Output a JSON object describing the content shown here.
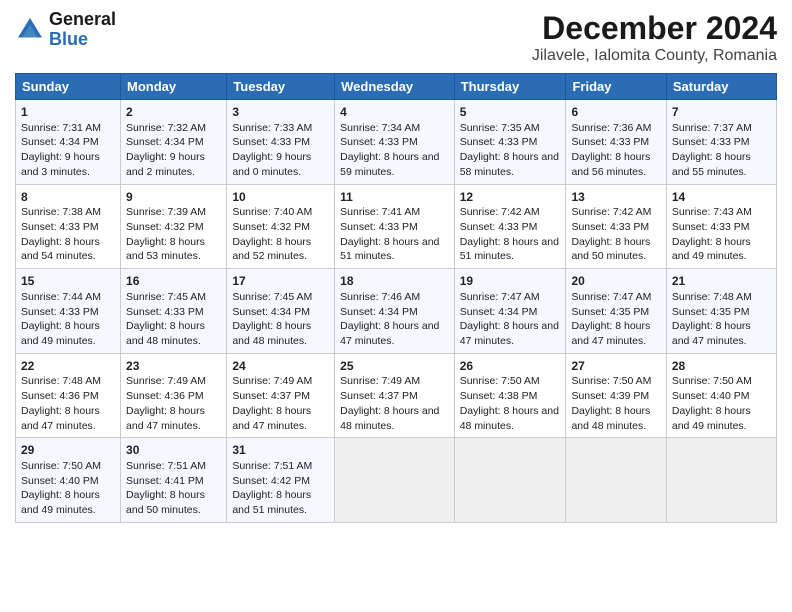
{
  "header": {
    "logo_line1": "General",
    "logo_line2": "Blue",
    "title": "December 2024",
    "subtitle": "Jilavele, Ialomita County, Romania"
  },
  "days_of_week": [
    "Sunday",
    "Monday",
    "Tuesday",
    "Wednesday",
    "Thursday",
    "Friday",
    "Saturday"
  ],
  "weeks": [
    {
      "days": [
        {
          "num": "1",
          "sunrise": "Sunrise: 7:31 AM",
          "sunset": "Sunset: 4:34 PM",
          "daylight": "Daylight: 9 hours and 3 minutes."
        },
        {
          "num": "2",
          "sunrise": "Sunrise: 7:32 AM",
          "sunset": "Sunset: 4:34 PM",
          "daylight": "Daylight: 9 hours and 2 minutes."
        },
        {
          "num": "3",
          "sunrise": "Sunrise: 7:33 AM",
          "sunset": "Sunset: 4:33 PM",
          "daylight": "Daylight: 9 hours and 0 minutes."
        },
        {
          "num": "4",
          "sunrise": "Sunrise: 7:34 AM",
          "sunset": "Sunset: 4:33 PM",
          "daylight": "Daylight: 8 hours and 59 minutes."
        },
        {
          "num": "5",
          "sunrise": "Sunrise: 7:35 AM",
          "sunset": "Sunset: 4:33 PM",
          "daylight": "Daylight: 8 hours and 58 minutes."
        },
        {
          "num": "6",
          "sunrise": "Sunrise: 7:36 AM",
          "sunset": "Sunset: 4:33 PM",
          "daylight": "Daylight: 8 hours and 56 minutes."
        },
        {
          "num": "7",
          "sunrise": "Sunrise: 7:37 AM",
          "sunset": "Sunset: 4:33 PM",
          "daylight": "Daylight: 8 hours and 55 minutes."
        }
      ]
    },
    {
      "days": [
        {
          "num": "8",
          "sunrise": "Sunrise: 7:38 AM",
          "sunset": "Sunset: 4:33 PM",
          "daylight": "Daylight: 8 hours and 54 minutes."
        },
        {
          "num": "9",
          "sunrise": "Sunrise: 7:39 AM",
          "sunset": "Sunset: 4:32 PM",
          "daylight": "Daylight: 8 hours and 53 minutes."
        },
        {
          "num": "10",
          "sunrise": "Sunrise: 7:40 AM",
          "sunset": "Sunset: 4:32 PM",
          "daylight": "Daylight: 8 hours and 52 minutes."
        },
        {
          "num": "11",
          "sunrise": "Sunrise: 7:41 AM",
          "sunset": "Sunset: 4:33 PM",
          "daylight": "Daylight: 8 hours and 51 minutes."
        },
        {
          "num": "12",
          "sunrise": "Sunrise: 7:42 AM",
          "sunset": "Sunset: 4:33 PM",
          "daylight": "Daylight: 8 hours and 51 minutes."
        },
        {
          "num": "13",
          "sunrise": "Sunrise: 7:42 AM",
          "sunset": "Sunset: 4:33 PM",
          "daylight": "Daylight: 8 hours and 50 minutes."
        },
        {
          "num": "14",
          "sunrise": "Sunrise: 7:43 AM",
          "sunset": "Sunset: 4:33 PM",
          "daylight": "Daylight: 8 hours and 49 minutes."
        }
      ]
    },
    {
      "days": [
        {
          "num": "15",
          "sunrise": "Sunrise: 7:44 AM",
          "sunset": "Sunset: 4:33 PM",
          "daylight": "Daylight: 8 hours and 49 minutes."
        },
        {
          "num": "16",
          "sunrise": "Sunrise: 7:45 AM",
          "sunset": "Sunset: 4:33 PM",
          "daylight": "Daylight: 8 hours and 48 minutes."
        },
        {
          "num": "17",
          "sunrise": "Sunrise: 7:45 AM",
          "sunset": "Sunset: 4:34 PM",
          "daylight": "Daylight: 8 hours and 48 minutes."
        },
        {
          "num": "18",
          "sunrise": "Sunrise: 7:46 AM",
          "sunset": "Sunset: 4:34 PM",
          "daylight": "Daylight: 8 hours and 47 minutes."
        },
        {
          "num": "19",
          "sunrise": "Sunrise: 7:47 AM",
          "sunset": "Sunset: 4:34 PM",
          "daylight": "Daylight: 8 hours and 47 minutes."
        },
        {
          "num": "20",
          "sunrise": "Sunrise: 7:47 AM",
          "sunset": "Sunset: 4:35 PM",
          "daylight": "Daylight: 8 hours and 47 minutes."
        },
        {
          "num": "21",
          "sunrise": "Sunrise: 7:48 AM",
          "sunset": "Sunset: 4:35 PM",
          "daylight": "Daylight: 8 hours and 47 minutes."
        }
      ]
    },
    {
      "days": [
        {
          "num": "22",
          "sunrise": "Sunrise: 7:48 AM",
          "sunset": "Sunset: 4:36 PM",
          "daylight": "Daylight: 8 hours and 47 minutes."
        },
        {
          "num": "23",
          "sunrise": "Sunrise: 7:49 AM",
          "sunset": "Sunset: 4:36 PM",
          "daylight": "Daylight: 8 hours and 47 minutes."
        },
        {
          "num": "24",
          "sunrise": "Sunrise: 7:49 AM",
          "sunset": "Sunset: 4:37 PM",
          "daylight": "Daylight: 8 hours and 47 minutes."
        },
        {
          "num": "25",
          "sunrise": "Sunrise: 7:49 AM",
          "sunset": "Sunset: 4:37 PM",
          "daylight": "Daylight: 8 hours and 48 minutes."
        },
        {
          "num": "26",
          "sunrise": "Sunrise: 7:50 AM",
          "sunset": "Sunset: 4:38 PM",
          "daylight": "Daylight: 8 hours and 48 minutes."
        },
        {
          "num": "27",
          "sunrise": "Sunrise: 7:50 AM",
          "sunset": "Sunset: 4:39 PM",
          "daylight": "Daylight: 8 hours and 48 minutes."
        },
        {
          "num": "28",
          "sunrise": "Sunrise: 7:50 AM",
          "sunset": "Sunset: 4:40 PM",
          "daylight": "Daylight: 8 hours and 49 minutes."
        }
      ]
    },
    {
      "days": [
        {
          "num": "29",
          "sunrise": "Sunrise: 7:50 AM",
          "sunset": "Sunset: 4:40 PM",
          "daylight": "Daylight: 8 hours and 49 minutes."
        },
        {
          "num": "30",
          "sunrise": "Sunrise: 7:51 AM",
          "sunset": "Sunset: 4:41 PM",
          "daylight": "Daylight: 8 hours and 50 minutes."
        },
        {
          "num": "31",
          "sunrise": "Sunrise: 7:51 AM",
          "sunset": "Sunset: 4:42 PM",
          "daylight": "Daylight: 8 hours and 51 minutes."
        },
        null,
        null,
        null,
        null
      ]
    }
  ]
}
